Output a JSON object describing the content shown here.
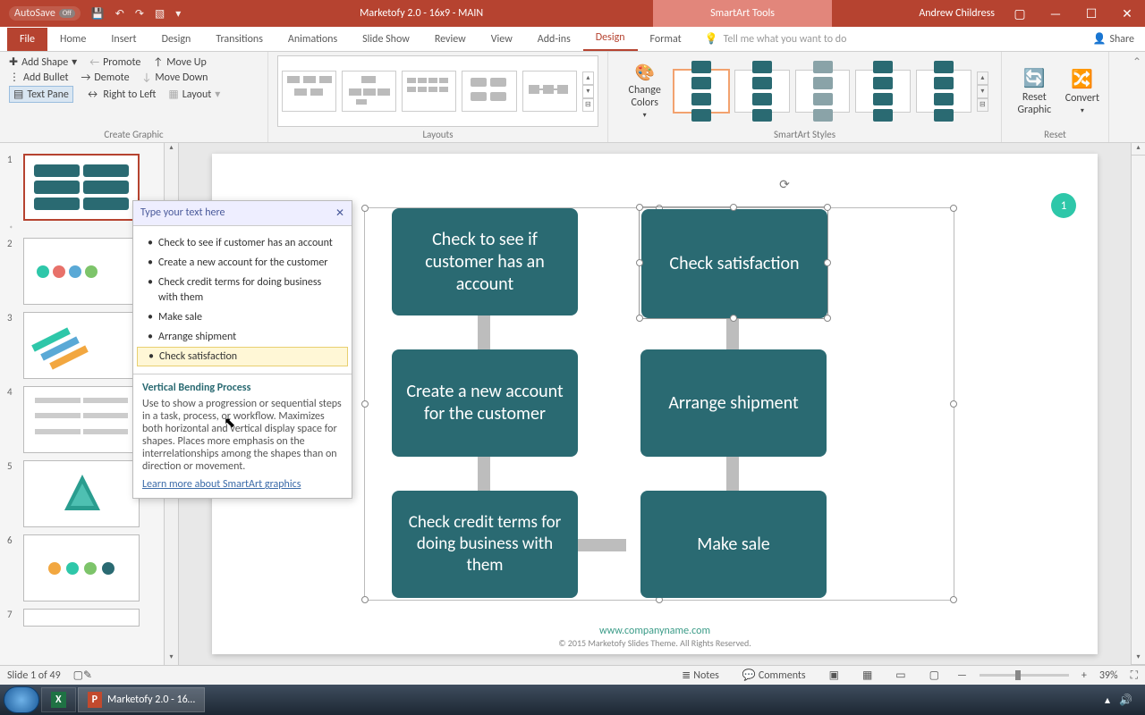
{
  "titlebar": {
    "autosave": "AutoSave",
    "autosave_state": "Off",
    "doc_title": "Marketofy 2.0 - 16x9 - MAIN",
    "context_tool": "SmartArt Tools",
    "user": "Andrew Childress"
  },
  "tabs": {
    "file": "File",
    "home": "Home",
    "insert": "Insert",
    "design_main": "Design",
    "transitions": "Transitions",
    "animations": "Animations",
    "slideshow": "Slide Show",
    "review": "Review",
    "view": "View",
    "addins": "Add-ins",
    "sa_design": "Design",
    "sa_format": "Format",
    "tell_me": "Tell me what you want to do",
    "share": "Share"
  },
  "ribbon": {
    "create": {
      "add_shape": "Add Shape",
      "add_bullet": "Add Bullet",
      "text_pane": "Text Pane",
      "promote": "Promote",
      "demote": "Demote",
      "rtl": "Right to Left",
      "move_up": "Move Up",
      "move_down": "Move Down",
      "layout": "Layout",
      "group": "Create Graphic"
    },
    "layouts": {
      "group": "Layouts"
    },
    "styles": {
      "change_colors": "Change Colors",
      "group": "SmartArt Styles"
    },
    "reset": {
      "reset": "Reset Graphic",
      "convert": "Convert",
      "group": "Reset"
    }
  },
  "textpane": {
    "title": "Type your text here",
    "items": [
      "Check to see if customer has an account",
      "Create a new account for the customer",
      "Check credit terms for doing business with them",
      "Make sale",
      "Arrange shipment",
      "Check satisfaction"
    ],
    "desc_title": "Vertical Bending Process",
    "desc_body": "Use to show a progression or sequential steps in a task, process, or workflow. Maximizes both horizontal and vertical display space for shapes. Places more emphasis on the interrelationships among the shapes than on direction or movement.",
    "learn_link": "Learn more about SmartArt graphics"
  },
  "smartart": {
    "b1": "Check to see if customer has an account",
    "b2": "Check satisfaction",
    "b3": "Create a new account for the customer",
    "b4": "Arrange shipment",
    "b5": "Check credit terms for doing business with them",
    "b6": "Make sale"
  },
  "slide_footer": {
    "url": "www.companyname.com",
    "copyright": "© 2015 Marketofy Slides Theme. All Rights Reserved."
  },
  "slide_badge": "1",
  "status": {
    "slide": "Slide 1 of 49",
    "notes": "Notes",
    "comments": "Comments",
    "zoom": "39%"
  },
  "taskbar": {
    "app": "Marketofy 2.0 - 16…"
  },
  "slide_numbers": {
    "s1": "1",
    "s2": "2",
    "s3": "3",
    "s4": "4",
    "s5": "5",
    "s6": "6",
    "s7": "7"
  }
}
